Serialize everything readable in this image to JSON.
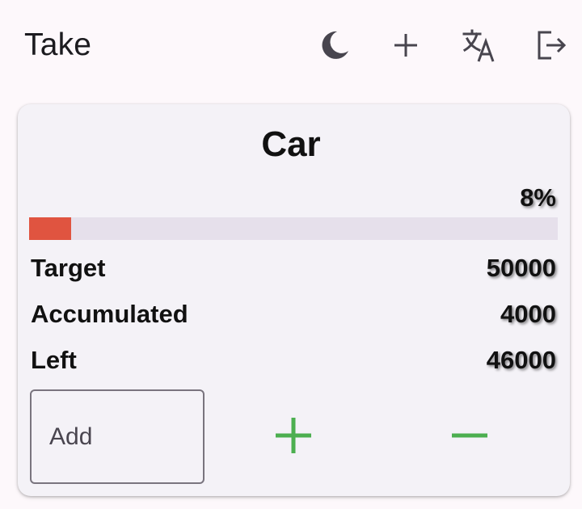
{
  "appbar": {
    "title": "Take",
    "actions": [
      {
        "name": "theme",
        "icon": "moon-icon"
      },
      {
        "name": "add",
        "icon": "plus-icon"
      },
      {
        "name": "language",
        "icon": "translate-icon"
      },
      {
        "name": "logout",
        "icon": "logout-icon"
      }
    ]
  },
  "goal": {
    "name": "Car",
    "percent_label": "8%",
    "progress_fraction": 0.08,
    "rows": {
      "target_label": "Target",
      "target_value": "50000",
      "accumulated_label": "Accumulated",
      "accumulated_value": "4000",
      "left_label": "Left",
      "left_value": "46000"
    },
    "input": {
      "value": "",
      "placeholder": "Add"
    },
    "buttons": {
      "increase_icon": "plus-icon",
      "decrease_icon": "minus-icon"
    }
  },
  "colors": {
    "background": "#fdf8fb",
    "card": "#f4f2f7",
    "progress_fill": "#e05440",
    "progress_track": "#e6e0eb",
    "action_green": "#4caf50",
    "icon_dark": "#48454e"
  }
}
